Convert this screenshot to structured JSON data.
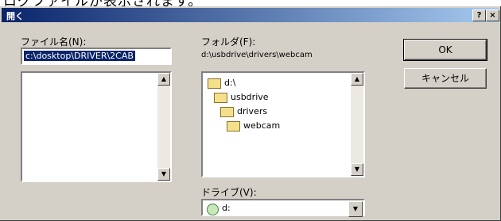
{
  "caption_top": "ログファイルが表示されます。",
  "dialog": {
    "title": "開く",
    "help_label": "?",
    "close_label": "×"
  },
  "filename": {
    "label": "ファイル名(N):",
    "value": "c:\\dosktop\\DRIVER\\2CAB"
  },
  "folder": {
    "label": "フォルダ(F):",
    "path": "d:\\usbdrive\\drivers\\webcam",
    "items": [
      {
        "name": "d:\\",
        "indent": 0
      },
      {
        "name": "usbdrive",
        "indent": 1
      },
      {
        "name": "drivers",
        "indent": 2
      },
      {
        "name": "webcam",
        "indent": 3
      }
    ]
  },
  "buttons": {
    "ok": "OK",
    "cancel": "キャンセル"
  },
  "drive": {
    "label": "ドライブ(V):",
    "value": "d:"
  },
  "scroll": {
    "up": "▲",
    "down": "▼"
  }
}
